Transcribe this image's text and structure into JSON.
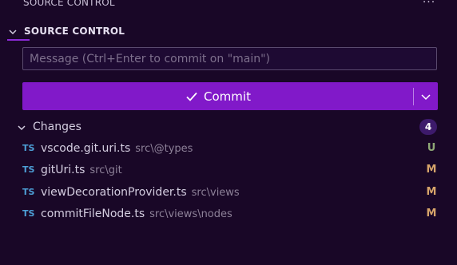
{
  "view": {
    "title": "SOURCE CONTROL",
    "more_icon": "ellipsis-icon"
  },
  "section": {
    "title": "SOURCE CONTROL",
    "expanded": true
  },
  "commit": {
    "placeholder": "Message (Ctrl+Enter to commit on \"main\")",
    "button_label": "Commit",
    "accent_color": "#8119c9"
  },
  "changes": {
    "label": "Changes",
    "count": "4",
    "files": [
      {
        "name": "vscode.git.uri.ts",
        "path": "src\\@types",
        "status": "U",
        "status_color": "#8fa876",
        "icon": "TS"
      },
      {
        "name": "gitUri.ts",
        "path": "src\\git",
        "status": "M",
        "status_color": "#d6a46a",
        "icon": "TS"
      },
      {
        "name": "viewDecorationProvider.ts",
        "path": "src\\views",
        "status": "M",
        "status_color": "#d6a46a",
        "icon": "TS"
      },
      {
        "name": "commitFileNode.ts",
        "path": "src\\views\\nodes",
        "status": "M",
        "status_color": "#d6a46a",
        "icon": "TS"
      }
    ]
  }
}
